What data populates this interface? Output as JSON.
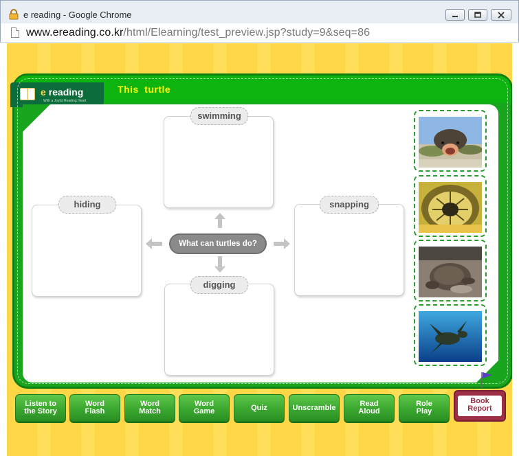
{
  "window": {
    "title": "e reading - Google Chrome",
    "url_host": "www.ereading.co.kr",
    "url_path": "/html/Elearning/test_preview.jsp?study=9&seq=86"
  },
  "header": {
    "logo_text": "reading",
    "logo_e": "e",
    "logo_subtitle": "With a Joyful Reading Heart",
    "lesson_title": "This turtle"
  },
  "concept_map": {
    "center_question": "What can turtles do?",
    "boxes": [
      {
        "label": "swimming"
      },
      {
        "label": "hiding"
      },
      {
        "label": "snapping"
      },
      {
        "label": "digging"
      }
    ]
  },
  "pictures": [
    {
      "name": "turtle-mouth-open-photo"
    },
    {
      "name": "turtle-shell-underside-photo"
    },
    {
      "name": "turtle-digging-sand-photo"
    },
    {
      "name": "sea-turtle-swimming-photo"
    }
  ],
  "nav_buttons": [
    {
      "line1": "Listen to",
      "line2": "the Story"
    },
    {
      "line1": "Word",
      "line2": "Flash"
    },
    {
      "line1": "Word",
      "line2": "Match"
    },
    {
      "line1": "Word",
      "line2": "Game"
    },
    {
      "line1": "Quiz",
      "line2": ""
    },
    {
      "line1": "Unscramble",
      "line2": ""
    },
    {
      "line1": "Read",
      "line2": "Aloud"
    },
    {
      "line1": "Role",
      "line2": "Play"
    }
  ],
  "book_report": {
    "line1": "Book",
    "line2": "Report"
  },
  "colors": {
    "board_green": "#1aa51f",
    "header_green": "#0db30e",
    "title_yellow": "#ffff00",
    "background_yellow": "#ffd84a",
    "report_red": "#9b2f45"
  }
}
